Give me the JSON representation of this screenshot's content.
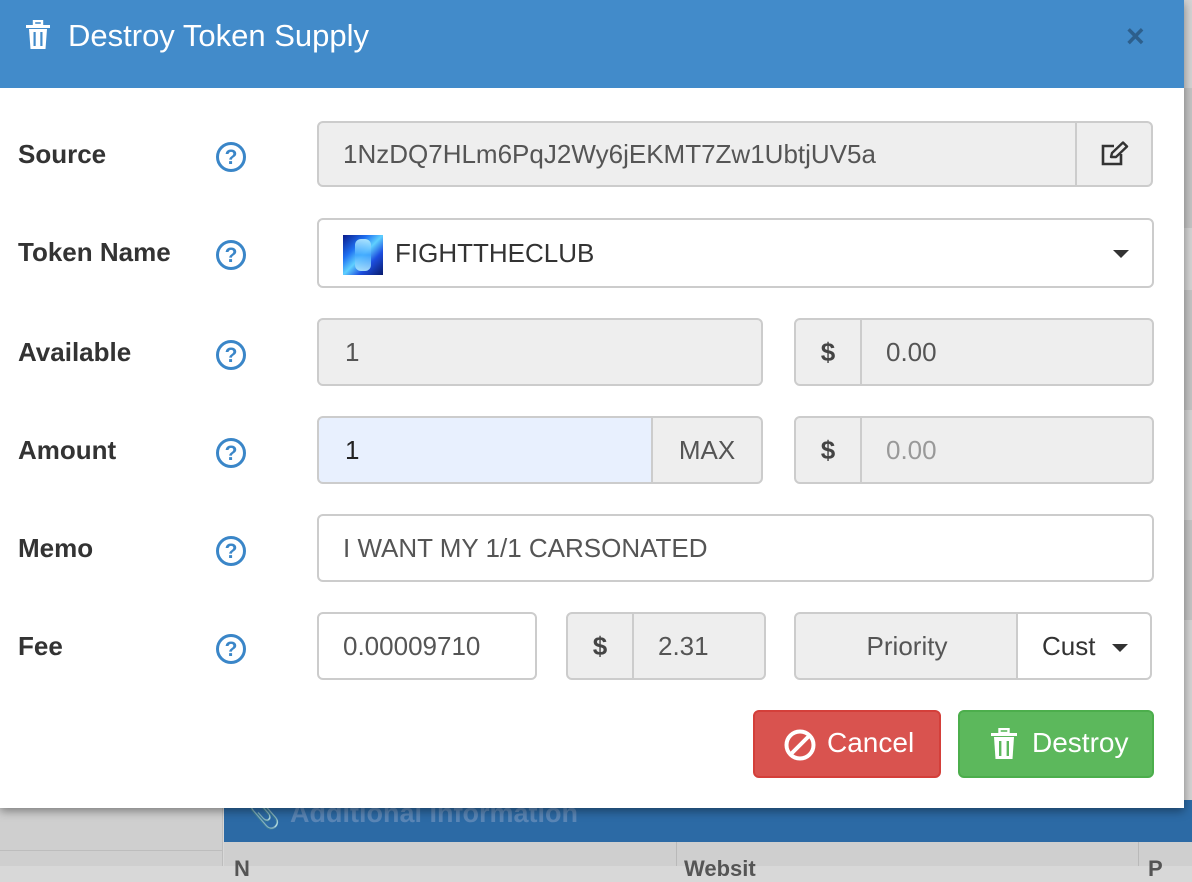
{
  "modal": {
    "title": "Destroy Token Supply",
    "close_label": "×"
  },
  "help_label": "?",
  "source": {
    "label": "Source",
    "value": "1NzDQ7HLm6PqJ2Wy6jEKMT7Zw1UbtjUV5a",
    "edit_icon": "edit-icon"
  },
  "token": {
    "label": "Token Name",
    "value": "FIGHTTHECLUB"
  },
  "available": {
    "label": "Available",
    "value": "1",
    "currency": "$",
    "usd": "0.00"
  },
  "amount": {
    "label": "Amount",
    "value": "1",
    "max_label": "MAX",
    "currency": "$",
    "usd_placeholder": "0.00"
  },
  "memo": {
    "label": "Memo",
    "value": "I WANT MY 1/1 CARSONATED"
  },
  "fee": {
    "label": "Fee",
    "value": "0.00009710",
    "currency": "$",
    "usd": "2.31",
    "priority_label": "Priority",
    "priority_select": "Cust"
  },
  "buttons": {
    "cancel": "Cancel",
    "destroy": "Destroy"
  },
  "background": {
    "panel_title": "Additional Information",
    "columns": [
      "N",
      "Websit",
      "P"
    ]
  },
  "colors": {
    "header": "#428bca",
    "cancel": "#d9534f",
    "destroy": "#5cb85c",
    "help": "#3a86c8"
  }
}
